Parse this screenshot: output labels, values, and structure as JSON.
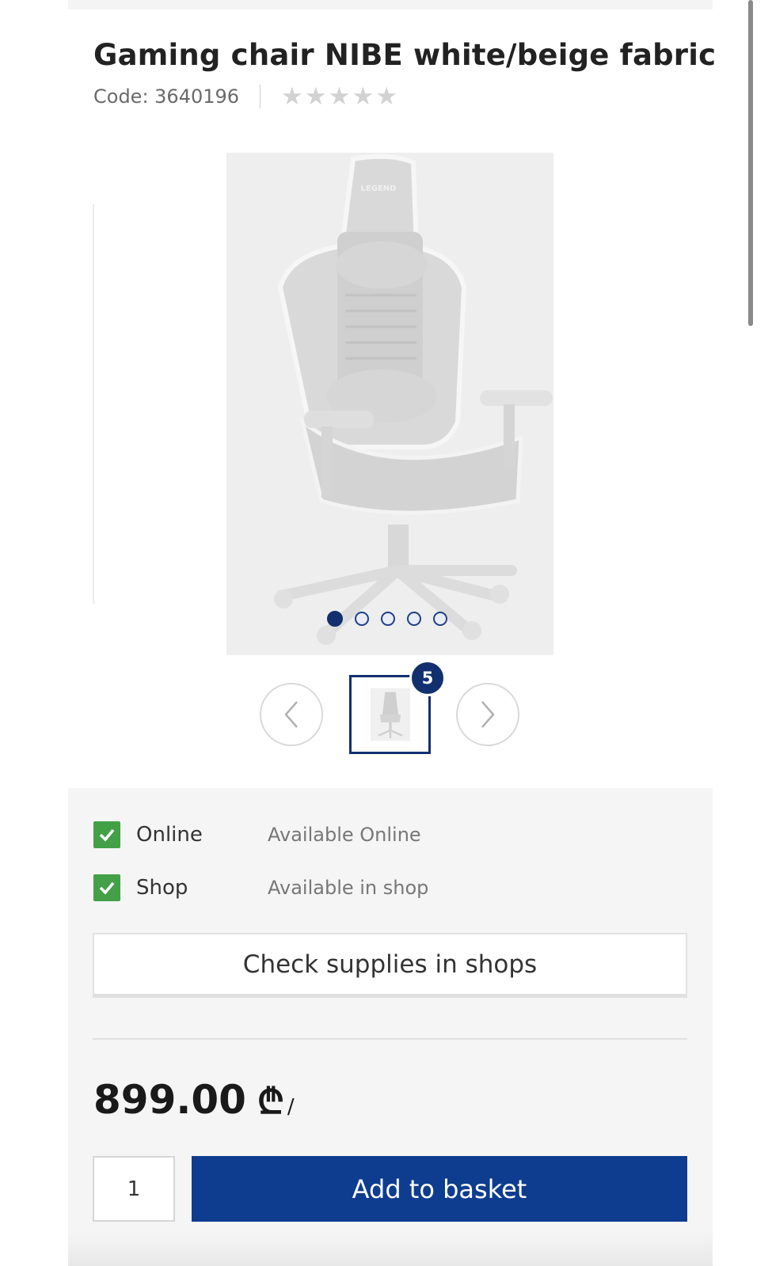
{
  "product": {
    "title": "Gaming chair NIBE white/beige fabric",
    "code": "Code: 3640196",
    "rating": 0,
    "rating_max": 5,
    "image_brand_text": "LEGEND"
  },
  "gallery": {
    "image_count": 5,
    "active_index": 0,
    "badge": "5"
  },
  "availability": [
    {
      "label": "Online",
      "status": "Available Online",
      "checked": true
    },
    {
      "label": "Shop",
      "status": "Available in shop",
      "checked": true
    }
  ],
  "check_supplies_label": "Check supplies in shops",
  "price": {
    "amount": "899.00",
    "currency": "₾",
    "unit": "/"
  },
  "basket": {
    "quantity": "1",
    "add_label": "Add to basket"
  },
  "colors": {
    "primary": "#0e3d8f",
    "accent_dark": "#12306e",
    "check_green": "#43a047"
  }
}
